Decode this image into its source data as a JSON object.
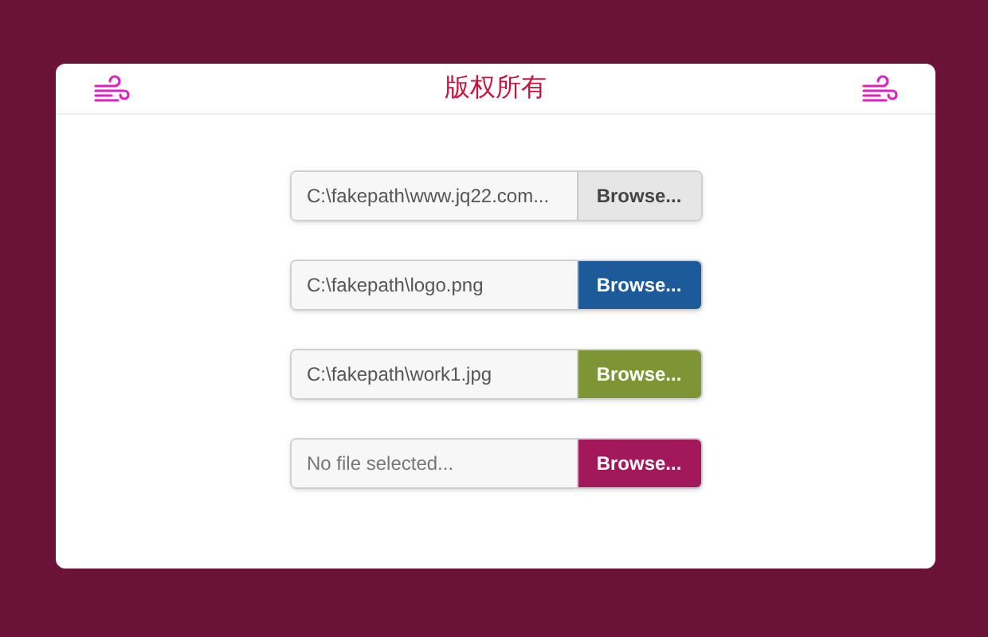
{
  "header": {
    "title": "版权所有"
  },
  "file_inputs": [
    {
      "value": "C:\\fakepath\\www.jq22.com...",
      "button": "Browse...",
      "color": "#e6e6e6"
    },
    {
      "value": "C:\\fakepath\\logo.png",
      "button": "Browse...",
      "color": "#1c5a9a"
    },
    {
      "value": "C:\\fakepath\\work1.jpg",
      "button": "Browse...",
      "color": "#7e9535"
    },
    {
      "placeholder": "No file selected...",
      "button": "Browse...",
      "color": "#a3185a"
    }
  ]
}
